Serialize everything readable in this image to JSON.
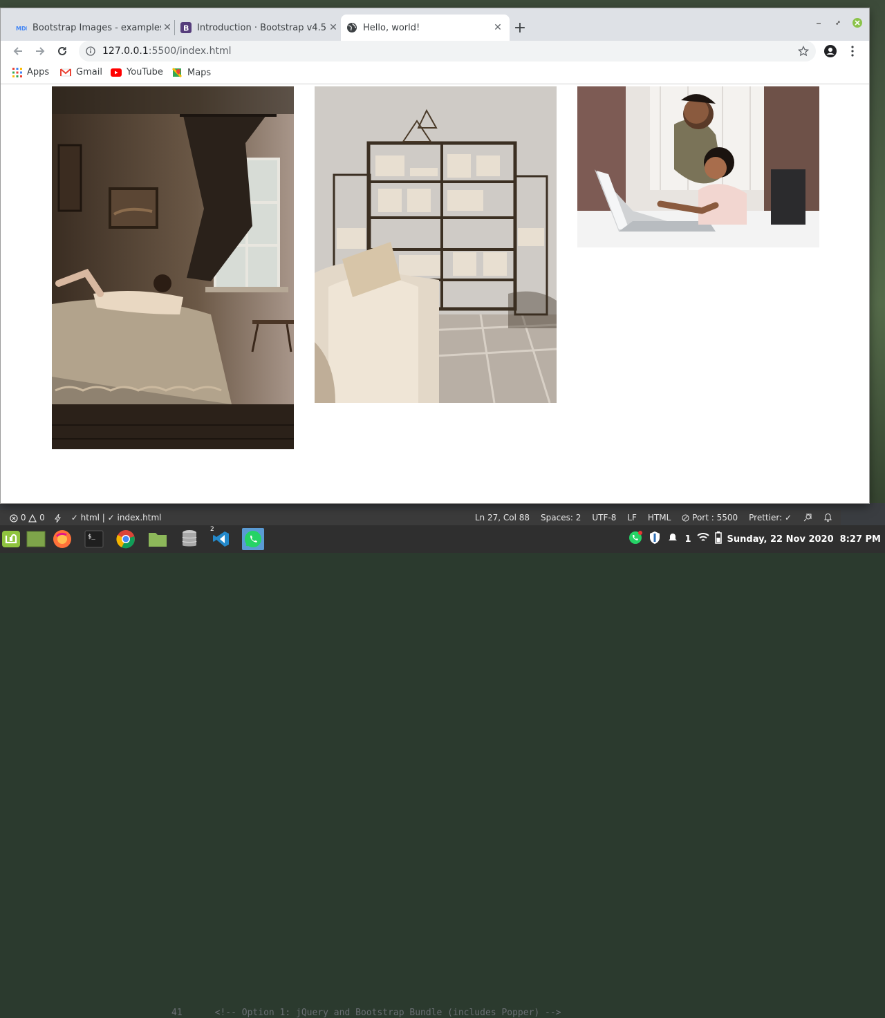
{
  "browser": {
    "tabs": [
      {
        "title": "Bootstrap Images - examples &",
        "favicon": "mdb-icon"
      },
      {
        "title": "Introduction · Bootstrap v4.5",
        "favicon": "bootstrap-icon"
      },
      {
        "title": "Hello, world!",
        "favicon": "globe-icon",
        "active": true
      }
    ],
    "url_host": "127.0.0.1",
    "url_path": ":5500/index.html",
    "bookmarks": [
      "Apps",
      "Gmail",
      "YouTube",
      "Maps"
    ]
  },
  "page": {
    "images": [
      {
        "name": "bedroom-photo",
        "description": "Woman lying on bed near window with dark curtain"
      },
      {
        "name": "living-room-photo",
        "description": "Sofa in front of metal bookshelf with books and frames"
      },
      {
        "name": "laptop-photo",
        "description": "Mother helping daughter using laptop at desk"
      }
    ]
  },
  "editor": {
    "line_number": "41",
    "ghost_code": "<!-- Option 1: jQuery and Bootstrap Bundle (includes Popper) -->",
    "status": {
      "errors": "0",
      "warnings": "0",
      "lang_check": "html",
      "file_check": "index.html",
      "cursor": "Ln 27, Col 88",
      "spaces": "Spaces: 2",
      "encoding": "UTF-8",
      "eol": "LF",
      "mode": "HTML",
      "port": "Port : 5500",
      "prettier": "Prettier: ✓"
    }
  },
  "taskbar": {
    "apps": [
      "mint-menu-icon",
      "show-desktop-icon",
      "firefox-icon",
      "terminal-icon",
      "chrome-icon",
      "files-icon",
      "database-icon",
      "vscode-icon",
      "whatsapp-icon"
    ],
    "vscode_badge": "2",
    "tray_count": "1",
    "datetime": "Sunday, 22 Nov 2020  8:27 PM"
  }
}
